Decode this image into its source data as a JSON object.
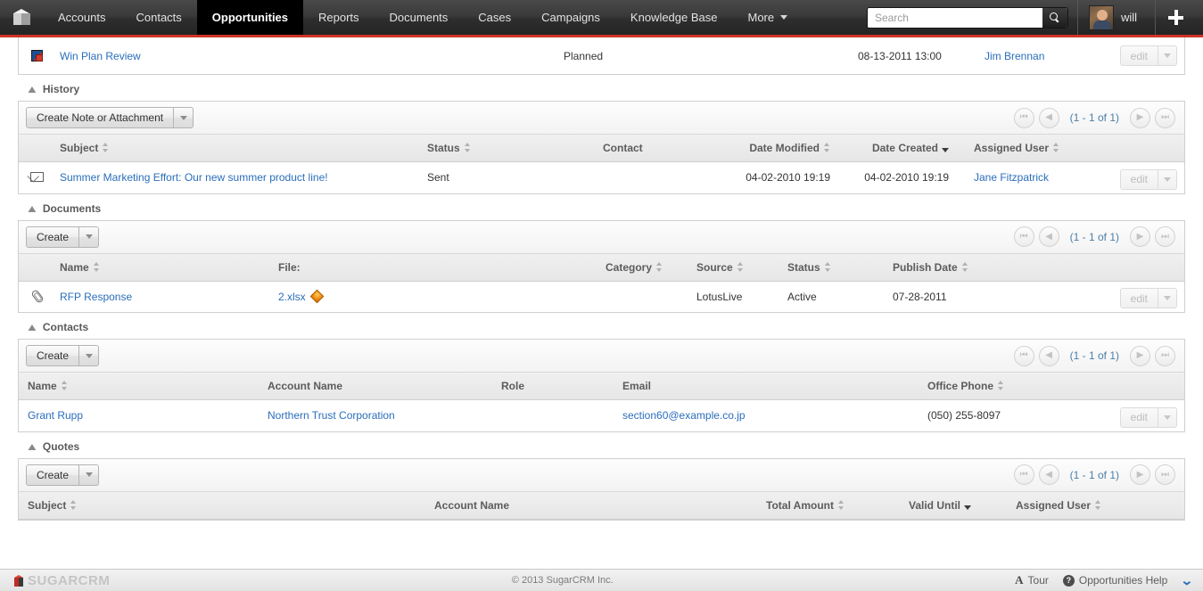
{
  "nav": {
    "logo_icon": "cube-logo-icon",
    "items": [
      {
        "label": "Accounts",
        "active": false
      },
      {
        "label": "Contacts",
        "active": false
      },
      {
        "label": "Opportunities",
        "active": true
      },
      {
        "label": "Reports",
        "active": false
      },
      {
        "label": "Documents",
        "active": false
      },
      {
        "label": "Cases",
        "active": false
      },
      {
        "label": "Campaigns",
        "active": false
      },
      {
        "label": "Knowledge Base",
        "active": false
      },
      {
        "label": "More",
        "active": false,
        "has_caret": true
      }
    ],
    "search": {
      "placeholder": "Search",
      "value": "",
      "icon": "search-icon"
    },
    "user": {
      "name": "will",
      "avatar": "user-avatar"
    },
    "quick_create": {
      "icon": "plus-icon"
    }
  },
  "activities_row": {
    "icon": "meeting-icon",
    "subject": "Win Plan Review",
    "status": "Planned",
    "date": "08-13-2011 13:00",
    "assigned_user": "Jim Brennan",
    "edit_label": "edit"
  },
  "history": {
    "title": "History",
    "create_label": "Create Note or Attachment",
    "pager": "(1 - 1 of 1)",
    "columns": [
      {
        "label": "Subject",
        "sortable": true,
        "active": false
      },
      {
        "label": "Status",
        "sortable": true,
        "active": false
      },
      {
        "label": "Contact",
        "sortable": false,
        "active": false
      },
      {
        "label": "Date Modified",
        "sortable": true,
        "active": false
      },
      {
        "label": "Date Created",
        "sortable": true,
        "active": true
      },
      {
        "label": "Assigned User",
        "sortable": true,
        "active": false
      }
    ],
    "rows": [
      {
        "icon": "mail-icon",
        "subject": "Summer Marketing Effort:",
        "subject2": "Our new summer product line!",
        "status": "Sent",
        "contact": "",
        "date_modified": "04-02-2010 19:19",
        "date_created": "04-02-2010 19:19",
        "assigned_user": "Jane Fitzpatrick",
        "edit_label": "edit"
      }
    ]
  },
  "documents": {
    "title": "Documents",
    "create_label": "Create",
    "pager": "(1 - 1 of 1)",
    "columns": [
      {
        "label": "Name",
        "sortable": true,
        "active": false
      },
      {
        "label": "File:",
        "sortable": false,
        "active": false
      },
      {
        "label": "Category",
        "sortable": true,
        "active": false
      },
      {
        "label": "Source",
        "sortable": true,
        "active": false
      },
      {
        "label": "Status",
        "sortable": true,
        "active": false
      },
      {
        "label": "Publish Date",
        "sortable": true,
        "active": false
      }
    ],
    "rows": [
      {
        "icon": "paperclip-icon",
        "name": "RFP Response",
        "file": "2.xlsx",
        "file_icon": "orange-diamond-icon",
        "category": "",
        "source": "LotusLive",
        "status": "Active",
        "publish_date": "07-28-2011",
        "edit_label": "edit"
      }
    ]
  },
  "contacts": {
    "title": "Contacts",
    "create_label": "Create",
    "pager": "(1 - 1 of 1)",
    "columns": [
      {
        "label": "Name",
        "sortable": true,
        "active": false
      },
      {
        "label": "Account Name",
        "sortable": false,
        "active": false
      },
      {
        "label": "Role",
        "sortable": false,
        "active": false
      },
      {
        "label": "Email",
        "sortable": false,
        "active": false
      },
      {
        "label": "Office Phone",
        "sortable": true,
        "active": false
      }
    ],
    "rows": [
      {
        "name": "Grant Rupp",
        "account_name": "Northern Trust Corporation",
        "role": "",
        "email": "section60@example.co.jp",
        "office_phone": "(050) 255-8097",
        "edit_label": "edit"
      }
    ]
  },
  "quotes": {
    "title": "Quotes",
    "create_label": "Create",
    "pager": "(1 - 1 of 1)",
    "columns": [
      {
        "label": "Subject",
        "sortable": true,
        "active": false
      },
      {
        "label": "Account Name",
        "sortable": false,
        "active": false
      },
      {
        "label": "Total Amount",
        "sortable": true,
        "active": false
      },
      {
        "label": "Valid Until",
        "sortable": true,
        "active": true
      },
      {
        "label": "Assigned User",
        "sortable": true,
        "active": false
      }
    ],
    "rows": []
  },
  "footer": {
    "brand_sugar": "SUGAR",
    "brand_crm": "CRM",
    "copyright": "© 2013 SugarCRM Inc.",
    "tour_label": "Tour",
    "help_label": "Opportunities Help",
    "tour_icon": "tour-a-icon",
    "help_icon": "question-mark-icon",
    "chevron_icon": "chevron-down-icon"
  },
  "colors": {
    "accent_red": "#cf3327",
    "link_blue": "#2a6ebb",
    "pager_blue": "#4a7fa8",
    "nav_dark": "#2e2e2e"
  }
}
